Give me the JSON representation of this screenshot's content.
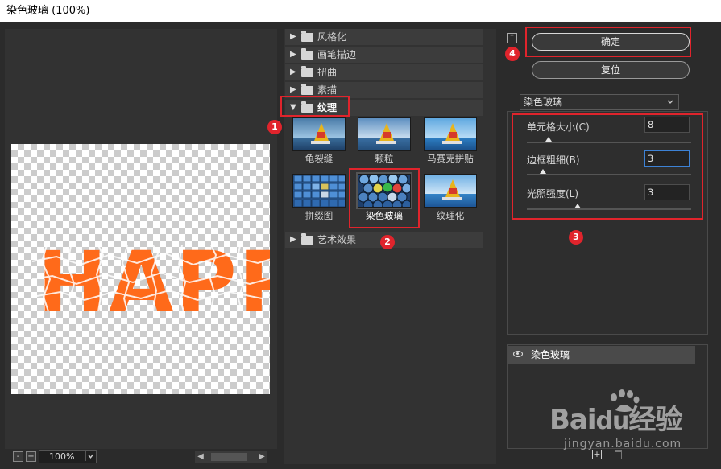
{
  "window": {
    "title": "染色玻璃 (100%)"
  },
  "preview": {
    "text": "HAPP",
    "zoom_level": "100%",
    "zoom_out_label": "-",
    "zoom_in_label": "+",
    "scroll_left": "◀",
    "scroll_right": "▶"
  },
  "filter_list": {
    "categories": [
      {
        "label": "风格化"
      },
      {
        "label": "画笔描边"
      },
      {
        "label": "扭曲"
      },
      {
        "label": "素描"
      },
      {
        "label": "纹理"
      },
      {
        "label": "艺术效果"
      }
    ],
    "texture_filters": [
      {
        "label": "龟裂缝"
      },
      {
        "label": "颗粒"
      },
      {
        "label": "马赛克拼贴"
      },
      {
        "label": "拼缀图"
      },
      {
        "label": "染色玻璃"
      },
      {
        "label": "纹理化"
      }
    ],
    "collapsed_glyph": "▶",
    "expanded_glyph": "▼"
  },
  "actions": {
    "ok_label": "确定",
    "reset_label": "复位"
  },
  "effect_select": {
    "value": "染色玻璃"
  },
  "params": [
    {
      "label": "单元格大小(C)",
      "value": "8",
      "slider": 0.13
    },
    {
      "label": "边框粗细(B)",
      "value": "3",
      "slider": 0.1
    },
    {
      "label": "光照强度(L)",
      "value": "3",
      "slider": 0.31
    }
  ],
  "effect_layers": [
    {
      "label": "染色玻璃"
    }
  ],
  "annotations": [
    "1",
    "2",
    "3",
    "4"
  ],
  "watermark": {
    "brand": "Bai",
    "brand_suffix": "经验",
    "site": "jingyan.baidu.com"
  },
  "colors": {
    "annotation_red": "#e0242c",
    "text_orange": "#ff6a1a",
    "panel_bg": "#2b2b2b",
    "focus_blue": "#3d82d6"
  }
}
